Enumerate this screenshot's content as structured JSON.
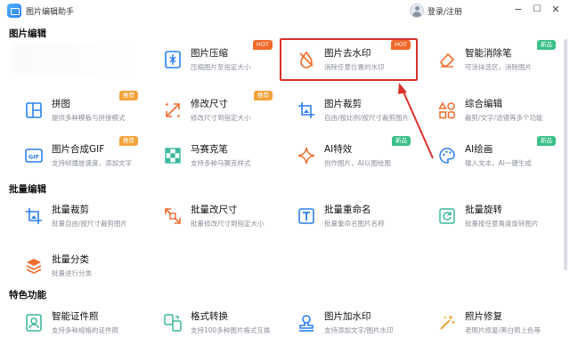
{
  "app": {
    "title": "图片编辑助手",
    "login_label": "登录/注册"
  },
  "window": {
    "minimize": "−",
    "maximize": "☐",
    "close": "✕"
  },
  "sections": {
    "editing": "图片编辑",
    "batch": "批量编辑",
    "special": "特色功能"
  },
  "cards": {
    "compress": {
      "title": "图片压缩",
      "desc": "压缩图片至指定大小",
      "badge": "HOT"
    },
    "watermark_remove": {
      "title": "图片去水印",
      "desc": "消除任意位置的水印",
      "badge": "HOT"
    },
    "eraser": {
      "title": "智能消除笔",
      "desc": "可涂抹选区，消除图片",
      "badge": "新品"
    },
    "collage": {
      "title": "拼图",
      "desc": "提供多种模板与拼接模式",
      "badge": "推荐"
    },
    "resize": {
      "title": "修改尺寸",
      "desc": "修改尺寸到指定大小",
      "badge": "推荐"
    },
    "crop": {
      "title": "图片裁剪",
      "desc": "自由/按比例/按尺寸裁剪图片"
    },
    "combo": {
      "title": "综合编辑",
      "desc": "裁剪/文字/滤镜等多个功能"
    },
    "gif": {
      "title": "图片合成GIF",
      "desc": "支持帧播放速度、添加文字",
      "badge": "推荐"
    },
    "mosaic": {
      "title": "马赛克笔",
      "desc": "支持多种马赛克样式"
    },
    "ai_effect": {
      "title": "AI特效",
      "desc": "创作图片，AI以图绘图",
      "badge": "新品"
    },
    "ai_draw": {
      "title": "AI绘画",
      "desc": "输入文本，AI一键生成",
      "badge": "新品"
    },
    "batch_crop": {
      "title": "批量裁剪",
      "desc": "批量自由/按尺寸裁剪图片"
    },
    "batch_resize": {
      "title": "批量改尺寸",
      "desc": "批量修改尺寸到指定大小"
    },
    "batch_rename": {
      "title": "批量重命名",
      "desc": "批量重命名图片名称"
    },
    "batch_rotate": {
      "title": "批量旋转",
      "desc": "批量按任意角度旋转图片"
    },
    "batch_classify": {
      "title": "批量分类",
      "desc": "批量进行分类"
    },
    "id_photo": {
      "title": "智能证件照",
      "desc": "支持多种规格的证件照"
    },
    "convert": {
      "title": "格式转换",
      "desc": "支持100多种图片格式互换"
    },
    "add_watermark": {
      "title": "图片加水印",
      "desc": "支持添加文字/图片水印"
    },
    "repair": {
      "title": "照片修复",
      "desc": "老照片修复/黑白照上色等"
    }
  },
  "colors": {
    "accent": "#2a7ef0",
    "hot": "#f06a2b",
    "recommend": "#f2a33c",
    "new": "#3cc08a",
    "highlight": "#d9312b"
  }
}
